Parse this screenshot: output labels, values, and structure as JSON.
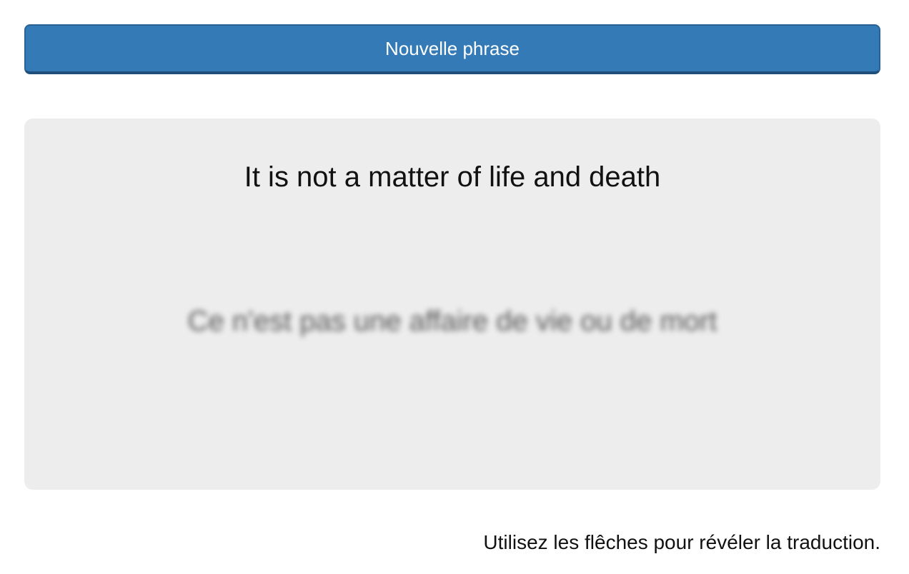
{
  "toolbar": {
    "new_phrase_label": "Nouvelle phrase"
  },
  "card": {
    "source_sentence": "It is not a matter of life and death",
    "translation_sentence": "Ce n'est pas une affaire de vie ou de mort",
    "translation_state": "blurred"
  },
  "footer": {
    "hint": "Utilisez les flêches pour révéler la traduction."
  },
  "colors": {
    "accent": "#337ab7",
    "card_background": "#ededed"
  }
}
